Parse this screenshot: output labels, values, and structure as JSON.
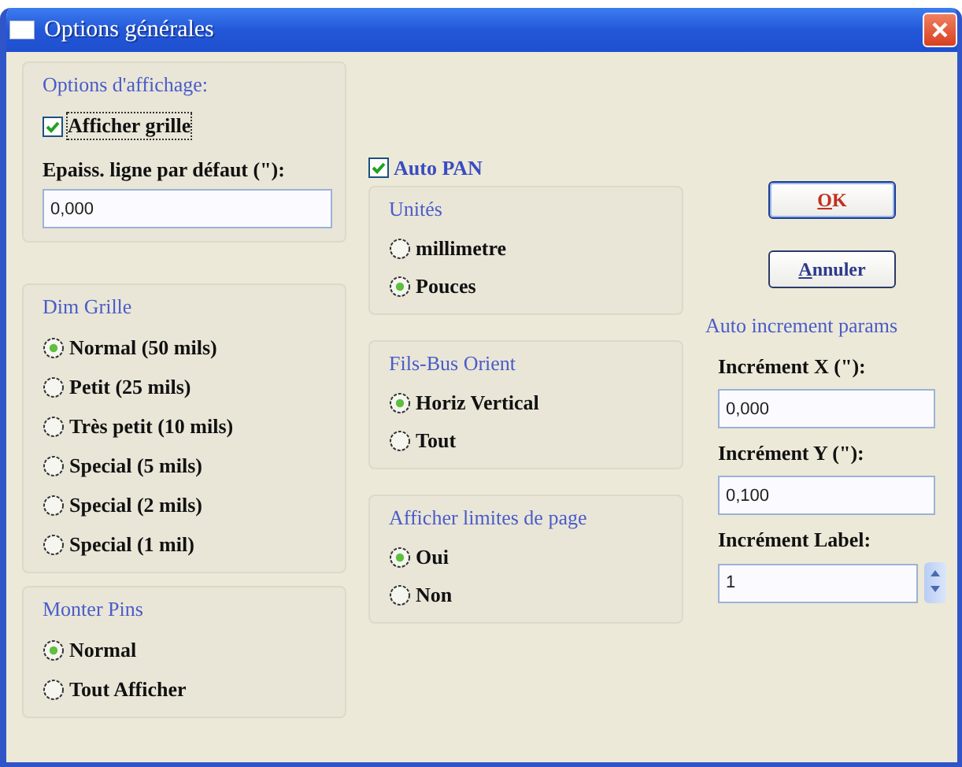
{
  "window": {
    "title": "Options générales"
  },
  "display_options": {
    "title": "Options d'affichage:",
    "show_grid": {
      "label": "Afficher grille",
      "checked": true
    },
    "line_width": {
      "label": "Epaiss. ligne par défaut (\"):",
      "value": "0,000"
    }
  },
  "grid_size": {
    "title": "Dim Grille",
    "options": [
      {
        "label": "Normal (50 mils)",
        "selected": true
      },
      {
        "label": "Petit (25 mils)",
        "selected": false
      },
      {
        "label": "Très petit (10 mils)",
        "selected": false
      },
      {
        "label": "Special (5 mils)",
        "selected": false
      },
      {
        "label": "Special (2 mils)",
        "selected": false
      },
      {
        "label": "Special (1 mil)",
        "selected": false
      }
    ]
  },
  "pins": {
    "title": "Monter Pins",
    "options": [
      {
        "label": "Normal",
        "selected": true
      },
      {
        "label": "Tout Afficher",
        "selected": false
      }
    ]
  },
  "auto_pan": {
    "label": "Auto PAN",
    "checked": true
  },
  "units": {
    "title": "Unités",
    "options": [
      {
        "label": "millimetre",
        "selected": false
      },
      {
        "label": "Pouces",
        "selected": true
      }
    ]
  },
  "wire_orient": {
    "title": "Fils-Bus Orient",
    "options": [
      {
        "label": "Horiz Vertical",
        "selected": true
      },
      {
        "label": "Tout",
        "selected": false
      }
    ]
  },
  "page_limits": {
    "title": "Afficher limites de page",
    "options": [
      {
        "label": "Oui",
        "selected": true
      },
      {
        "label": "Non",
        "selected": false
      }
    ]
  },
  "buttons": [
    {
      "label": "OK",
      "kind": "default"
    },
    {
      "label": "Annuler",
      "kind": "normal"
    }
  ],
  "auto_increment": {
    "title": "Auto increment params",
    "fields": [
      {
        "label": "Incrément X (\"):",
        "value": "0,000",
        "kind": "text"
      },
      {
        "label": "Incrément Y (\"):",
        "value": "0,100",
        "kind": "text"
      },
      {
        "label": "Incrément Label:",
        "value": "1",
        "kind": "spin"
      }
    ]
  }
}
